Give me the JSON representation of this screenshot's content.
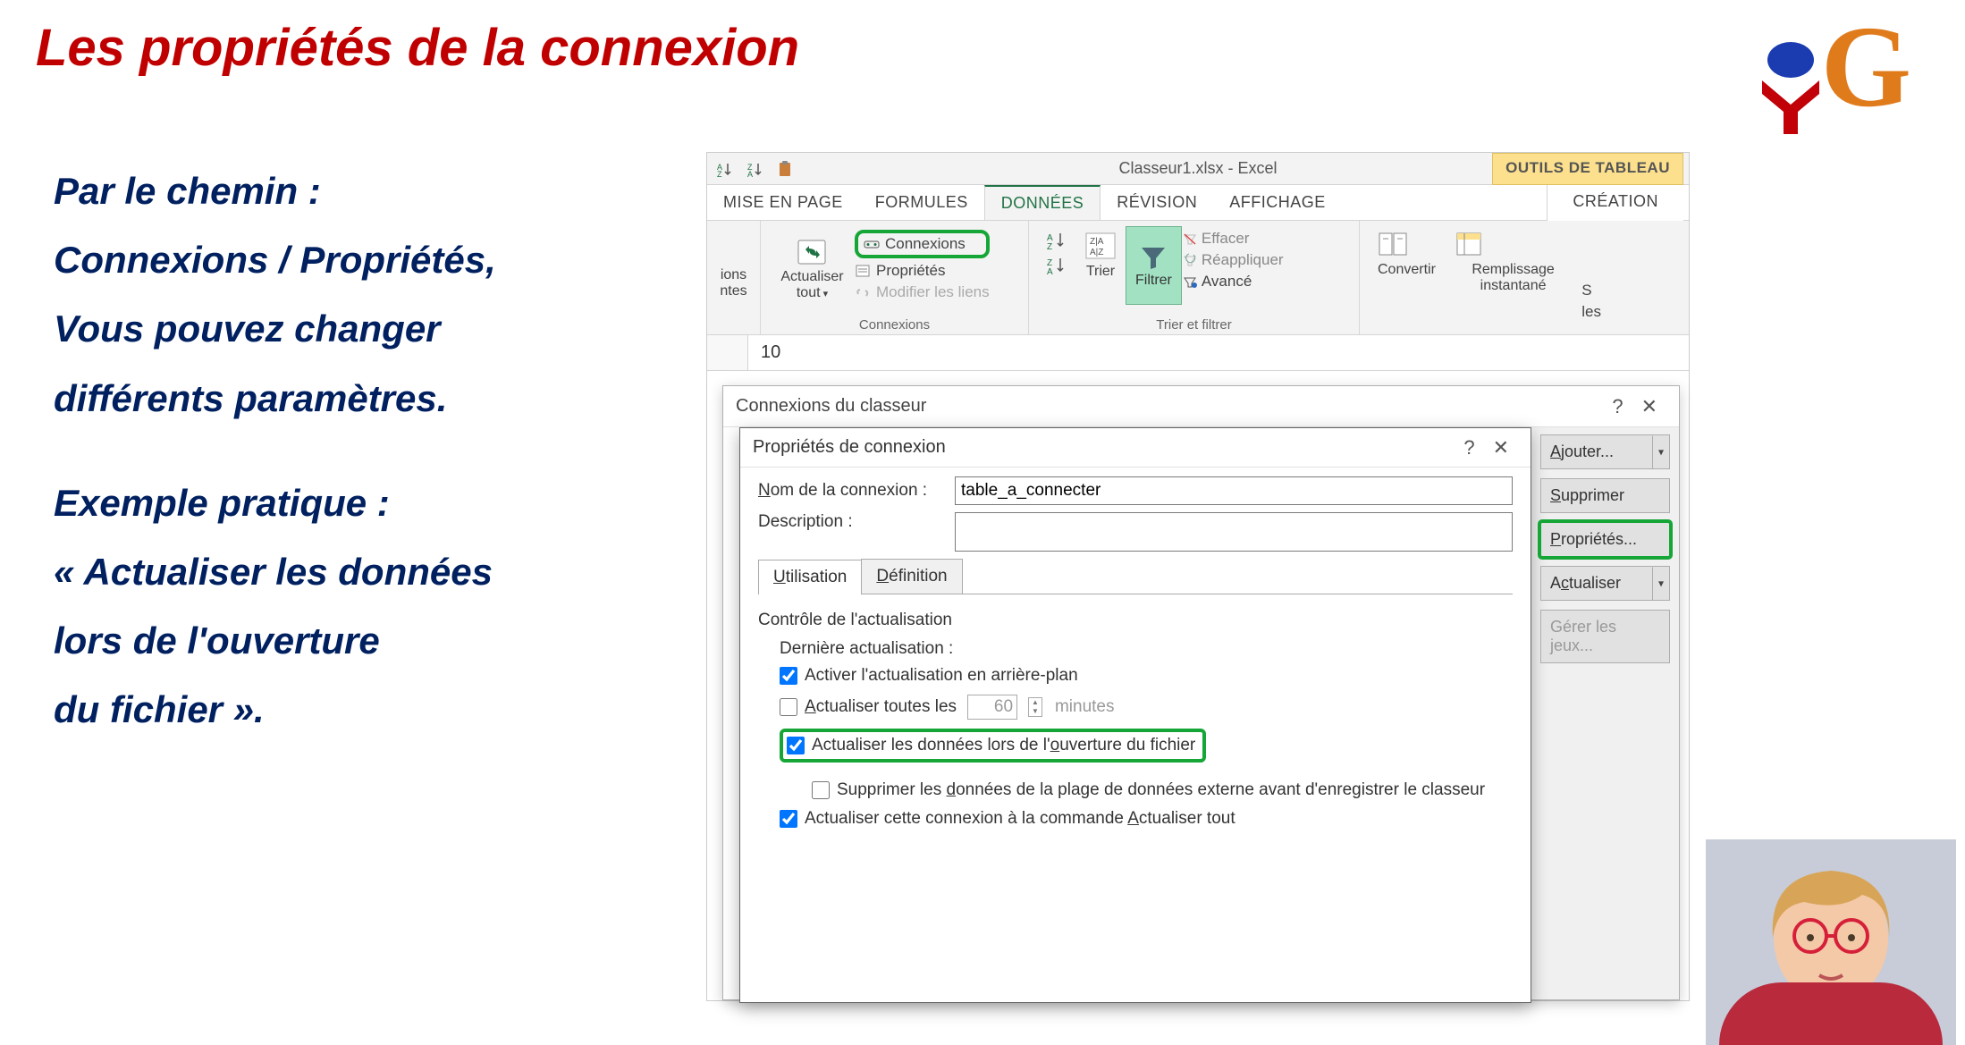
{
  "slide": {
    "title": "Les propriétés de la connexion",
    "p1": "Par le chemin :",
    "p2": "Connexions / Propriétés,",
    "p3": "Vous pouvez changer",
    "p4": "différents paramètres.",
    "p5": "Exemple pratique :",
    "p6": "« Actualiser les données",
    "p7": "lors de l'ouverture",
    "p8": "du fichier »."
  },
  "logo": {
    "letter": "G"
  },
  "qat": {
    "title": "Classeur1.xlsx - Excel",
    "tool_tab": "OUTILS DE TABLEAU"
  },
  "tabs": {
    "t1": "MISE EN PAGE",
    "t2": "FORMULES",
    "t3": "DONNÉES",
    "t4": "RÉVISION",
    "t5": "AFFICHAGE",
    "sub": "CRÉATION"
  },
  "ribbon": {
    "g1_top": "ions",
    "g1_bot": "ntes",
    "g2": {
      "refresh": "Actualiser tout",
      "connexions": "Connexions",
      "proprietes": "Propriétés",
      "modifier": "Modifier les liens",
      "label": "Connexions"
    },
    "g3": {
      "trier": "Trier",
      "filtrer": "Filtrer",
      "effacer": "Effacer",
      "reappliquer": "Réappliquer",
      "avance": "Avancé",
      "label": "Trier et filtrer"
    },
    "g4": {
      "convertir": "Convertir",
      "remplissage": "Remplissage instantané",
      "s": "S",
      "les": "les"
    }
  },
  "fxbar": {
    "value": "10"
  },
  "panel": {
    "title": "Connexions du classeur",
    "side": {
      "ajouter": "Ajouter...",
      "supprimer": "Supprimer",
      "proprietes": "Propriétés...",
      "actualiser": "Actualiser",
      "gerer": "Gérer les jeux..."
    }
  },
  "dialog": {
    "title": "Propriétés de connexion",
    "nom_label": "Nom de la connexion :",
    "nom_value": "table_a_connecter",
    "desc_label": "Description :",
    "desc_value": "",
    "tab1": "Utilisation",
    "tab2": "Définition",
    "legend": "Contrôle de l'actualisation",
    "last": "Dernière actualisation :",
    "c1": "Activer l'actualisation en arrière-plan",
    "c2a": "Actualiser toutes les",
    "c2_value": "60",
    "c2_unit": "minutes",
    "c3": "Actualiser les données lors de l'ouverture du fichier",
    "c4": "Supprimer les données de la plage de données externe avant d'enregistrer le classeur",
    "c5": "Actualiser cette connexion à la commande Actualiser tout"
  }
}
